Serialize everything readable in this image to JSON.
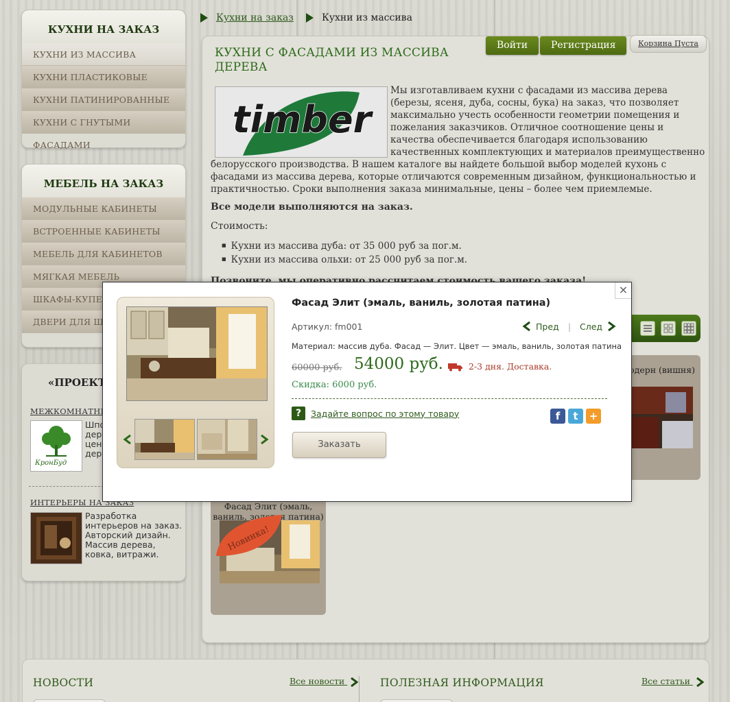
{
  "sidebar": {
    "kitchens": {
      "title": "КУХНИ НА ЗАКАЗ",
      "items": [
        "КУХНИ ИЗ МАССИВА",
        "КУХНИ ПЛАСТИКОВЫЕ",
        "КУХНИ ПАТИНИРОВАННЫЕ",
        "КУХНИ С ГНУТЫМИ ФАСАДАМИ"
      ]
    },
    "furniture": {
      "title": "МЕБЕЛЬ НА ЗАКАЗ",
      "items": [
        "МОДУЛЬНЫЕ КАБИНЕТЫ",
        "ВСТРОЕННЫЕ КАБИНЕТЫ",
        "МЕБЕЛЬ ДЛЯ КАБИНЕТОВ",
        "МЯГКАЯ МЕБЕЛЬ",
        "ШКАФЫ-КУПЕ Н",
        "ДВЕРИ ДЛЯ ШКА"
      ]
    },
    "promo": {
      "title": "«ПРОЕКТ",
      "doors_link": "МЕЖКОМНАТНЫ",
      "doors_text": [
        "Шпо",
        "дер",
        "цен",
        "дер"
      ],
      "kronbud_logo": "КронБуд",
      "interiors_link": "ИНТЕРЬЕРЫ НА ЗАКАЗ",
      "interiors_text": "Разработка интерьеров на заказ. Авторский дизайн. Массив дерева, ковка, витражи."
    }
  },
  "breadcrumb": {
    "link": "Кухни на заказ",
    "current": "Кухни из массива"
  },
  "header": {
    "login": "Войти",
    "register": "Регистрация",
    "cart": "Корзина Пуста"
  },
  "content": {
    "title": "КУХНИ С ФАСАДАМИ ИЗ МАССИВА ДЕРЕВА",
    "logo_text": "timber",
    "intro": "Мы изготавливаем кухни с фасадами из массива дерева (березы, ясеня, дуба, сосны, бука) на заказ, что позволяет максимально учесть особенности геометрии помещения и пожелания заказчиков. Отличное соотношение цены и качества обеспечивается благодаря использованию качественных комплектующих и материалов преимущественно белорусского производства. В нашем каталоге вы найдете большой выбор моделей кухонь с фасадами из массива дерева, которые отличаются современным дизайном, функциональностью и практичностью. Сроки выполнения заказа минимальные, цены – более чем приемлемые.",
    "bold_line": "Все модели выполняются на заказ.",
    "cost_label": "Стоимость:",
    "prices": [
      "Кухни из массива дуба: от 35 000 руб за пог.м.",
      "Кухни из массива ольхи: от 25 000 руб за пог.м."
    ],
    "call_line": "Позвоните, мы оперативно рассчитаем стоимость вашего заказа!",
    "cards": {
      "right_caption": "одерн (вишня)",
      "bottom_caption": "Фасад Элит (эмаль, ваниль, золотая патина)",
      "badge": "Новинка!"
    }
  },
  "bottom": {
    "news_title": "НОВОСТИ",
    "news_more": "Все новости",
    "info_title": "ПОЛЕЗНАЯ ИНФОРМАЦИЯ",
    "info_more": "Все статьи"
  },
  "modal": {
    "close": "×",
    "title": "Фасад Элит (эмаль, ваниль, золотая патина)",
    "article": "Артикул: fm001",
    "prev": "Пред",
    "sep": "|",
    "next": "След",
    "material": "Материал: массив дуба. Фасад — Элит. Цвет — эмаль, ваниль, золотая патина",
    "old_price": "60000 руб.",
    "new_price": "54000 руб.",
    "delivery": "2-3 дня. Доставка.",
    "discount": "Скидка: 6000 руб.",
    "ask": "Задайте вопрос по этому товару",
    "ask_icon": "?",
    "order": "Заказать",
    "social": [
      "f",
      "t",
      "+"
    ]
  },
  "colors": {
    "brand_green": "#2c6a1a",
    "button_green": "#5a7a18",
    "price_red": "#a83a2a"
  }
}
